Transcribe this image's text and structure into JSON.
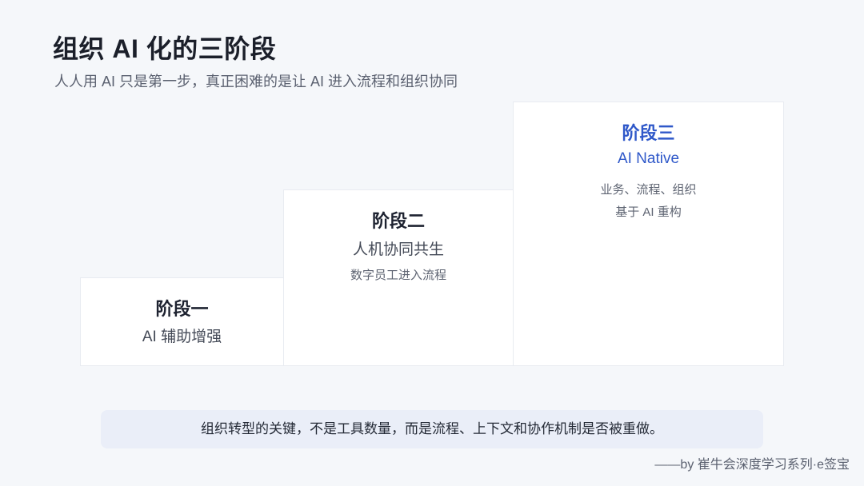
{
  "header": {
    "title": "组织 AI 化的三阶段",
    "subtitle": "人人用 AI 只是第一步，真正困难的是让 AI 进入流程和组织协同"
  },
  "stages": [
    {
      "name": "阶段一",
      "subtitle": "AI 辅助增强",
      "desc": []
    },
    {
      "name": "阶段二",
      "subtitle": "人机协同共生",
      "desc": [
        "数字员工进入流程"
      ]
    },
    {
      "name": "阶段三",
      "subtitle": "AI Native",
      "desc": [
        "业务、流程、组织",
        "基于 AI 重构"
      ]
    }
  ],
  "colors": {
    "accent": "#2f58c9",
    "background": "#f5f7fa",
    "card": "#ffffff",
    "callout_bg": "#eaeef8"
  },
  "callout": {
    "text": "组织转型的关键，不是工具数量，而是流程、上下文和协作机制是否被重做。"
  },
  "credit": {
    "text": "——by 崔牛会深度学习系列·e签宝"
  }
}
